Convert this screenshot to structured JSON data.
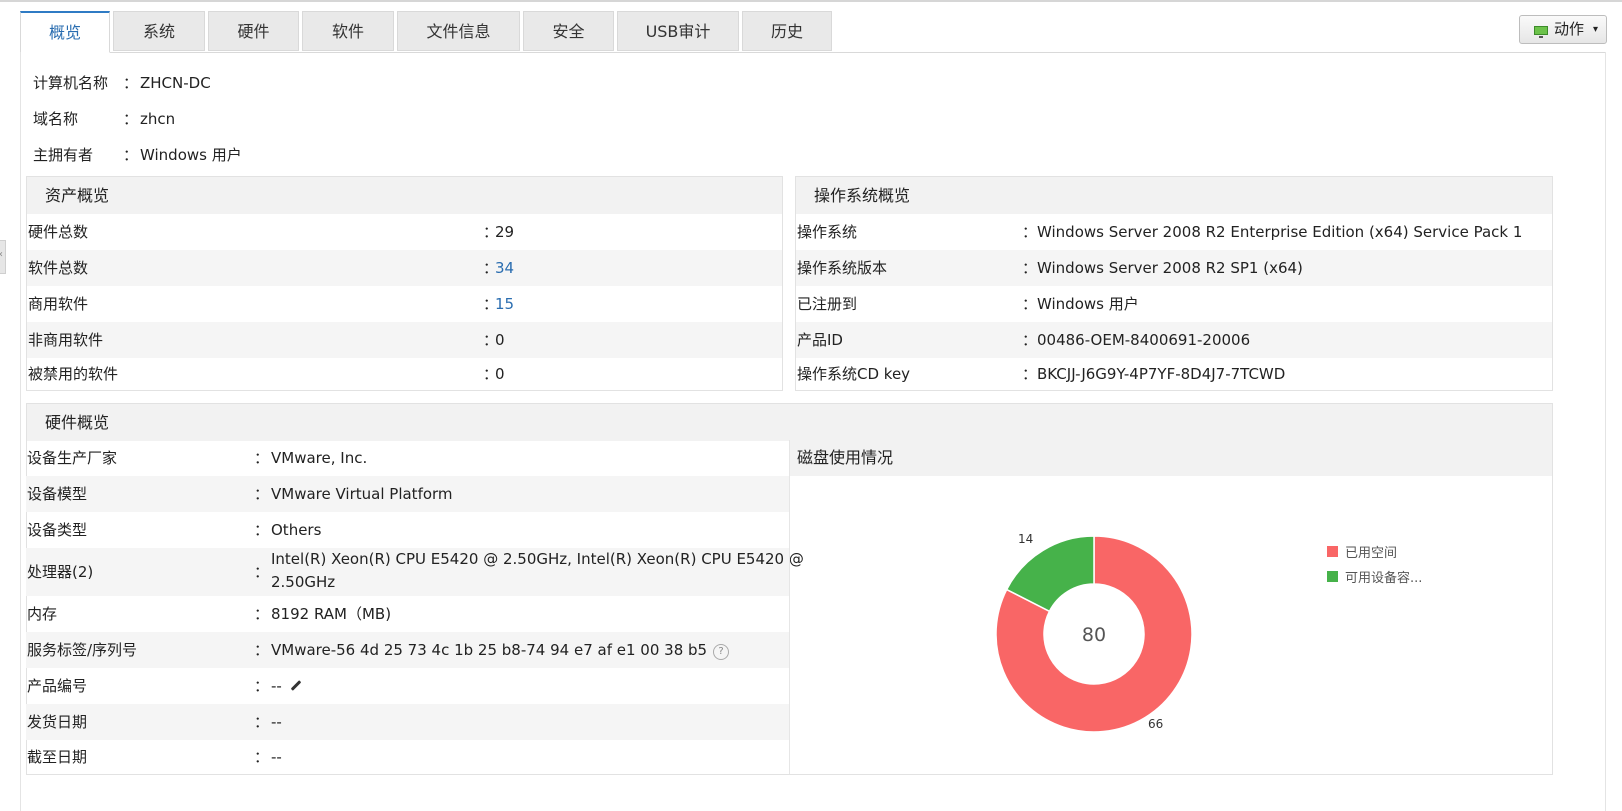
{
  "tabs": [
    {
      "label": "概览",
      "active": true
    },
    {
      "label": "系统",
      "active": false
    },
    {
      "label": "硬件",
      "active": false
    },
    {
      "label": "软件",
      "active": false
    },
    {
      "label": "文件信息",
      "active": false
    },
    {
      "label": "安全",
      "active": false
    },
    {
      "label": "USB审计",
      "active": false
    },
    {
      "label": "历史",
      "active": false
    }
  ],
  "action_button": {
    "label": "动作",
    "icon": "monitor-icon",
    "caret": "▾"
  },
  "summary": {
    "separator": "：",
    "computer_name": {
      "key": "计算机名称",
      "value": "ZHCN-DC"
    },
    "domain_name": {
      "key": "域名称",
      "value": "zhcn"
    },
    "owner": {
      "key": "主拥有者",
      "value": "Windows 用户"
    }
  },
  "asset_overview": {
    "title": "资产概览",
    "rows": [
      {
        "key": "硬件总数",
        "value": "29",
        "link": false
      },
      {
        "key": "软件总数",
        "value": "34",
        "link": true
      },
      {
        "key": "商用软件",
        "value": "15",
        "link": true
      },
      {
        "key": "非商用软件",
        "value": "0",
        "link": false
      },
      {
        "key": "被禁用的软件",
        "value": "0",
        "link": false
      }
    ]
  },
  "os_overview": {
    "title": "操作系统概览",
    "rows": [
      {
        "key": "操作系统",
        "value": "Windows Server 2008 R2 Enterprise Edition (x64) Service Pack 1"
      },
      {
        "key": "操作系统版本",
        "value": "Windows Server 2008 R2 SP1 (x64)"
      },
      {
        "key": "已注册到",
        "value": "Windows 用户"
      },
      {
        "key": "产品ID",
        "value": "00486-OEM-8400691-20006"
      },
      {
        "key": "操作系统CD key",
        "value": "BKCJJ-J6G9Y-4P7YF-8D4J7-7TCWD"
      }
    ]
  },
  "hardware_overview": {
    "title": "硬件概览",
    "rows": [
      {
        "key": "设备生产厂家",
        "value": "VMware, Inc."
      },
      {
        "key": "设备模型",
        "value": "VMware Virtual Platform"
      },
      {
        "key": "设备类型",
        "value": "Others"
      },
      {
        "key": "处理器(2)",
        "value_line1": "Intel(R) Xeon(R) CPU E5420 @ 2.50GHz, Intel(R) Xeon(R) CPU E5420 @",
        "value_line2": "2.50GHz"
      },
      {
        "key": "内存",
        "value": "8192 RAM（MB)"
      },
      {
        "key": "服务标签/序列号",
        "value": "VMware-56 4d 25 73 4c 1b 25 b8-74 94 e7 af e1 00 38 b5",
        "help": "?"
      },
      {
        "key": "产品编号",
        "value": "--"
      },
      {
        "key": "发货日期",
        "value": "--"
      },
      {
        "key": "截至日期",
        "value": "--"
      }
    ]
  },
  "disk_usage": {
    "title": "磁盘使用情况",
    "colors": {
      "used": "#f96666",
      "free": "#46b24a"
    }
  },
  "chart_data": {
    "type": "pie",
    "categories": [
      "已用空间",
      "可用设备容..."
    ],
    "values": [
      66,
      14
    ],
    "center_label": "80",
    "legend_position": "right"
  }
}
